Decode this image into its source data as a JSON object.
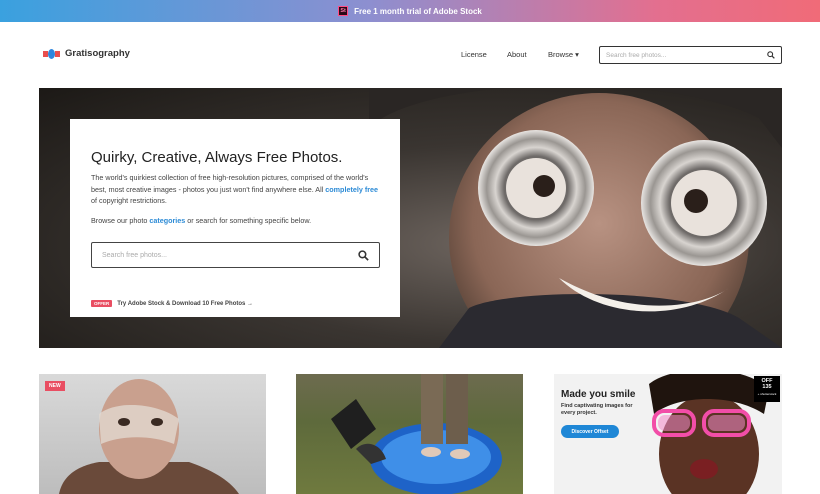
{
  "promo": {
    "icon_text": "St",
    "text": "Free 1 month trial of Adobe Stock",
    "icon": "adobe-stock-icon"
  },
  "header": {
    "logo_text": "Gratisography",
    "nav": {
      "license": "License",
      "about": "About",
      "browse": "Browse ▾"
    },
    "search_placeholder": "Search free photos...",
    "search_icon": "search-icon"
  },
  "hero": {
    "title": "Quirky, Creative, Always Free Photos.",
    "desc_pre": "The world's quirkiest collection of free high-resolution pictures, comprised of the world's best, most creative images - photos you just won't find anywhere else. All ",
    "desc_link": "completely free",
    "desc_post": " of copyright restrictions.",
    "browse_pre": "Browse our photo ",
    "browse_link": "categories",
    "browse_post": " or search for something specific below.",
    "search_placeholder": "Search free photos...",
    "offer_badge": "OFFER",
    "offer_text": "Try Adobe Stock & Download 10 Free Photos →"
  },
  "cards": {
    "new_badge": "NEW",
    "ad": {
      "title": "Made you smile",
      "subtitle": "Find captivating images for every project.",
      "button": "Discover Offset",
      "badge_line1": "OFF",
      "badge_line2": "135",
      "badge_line3": "+ shutterstock"
    }
  },
  "colors": {
    "link": "#2d8bd6",
    "badge": "#e94e62",
    "ad_button": "#1f87d6"
  }
}
